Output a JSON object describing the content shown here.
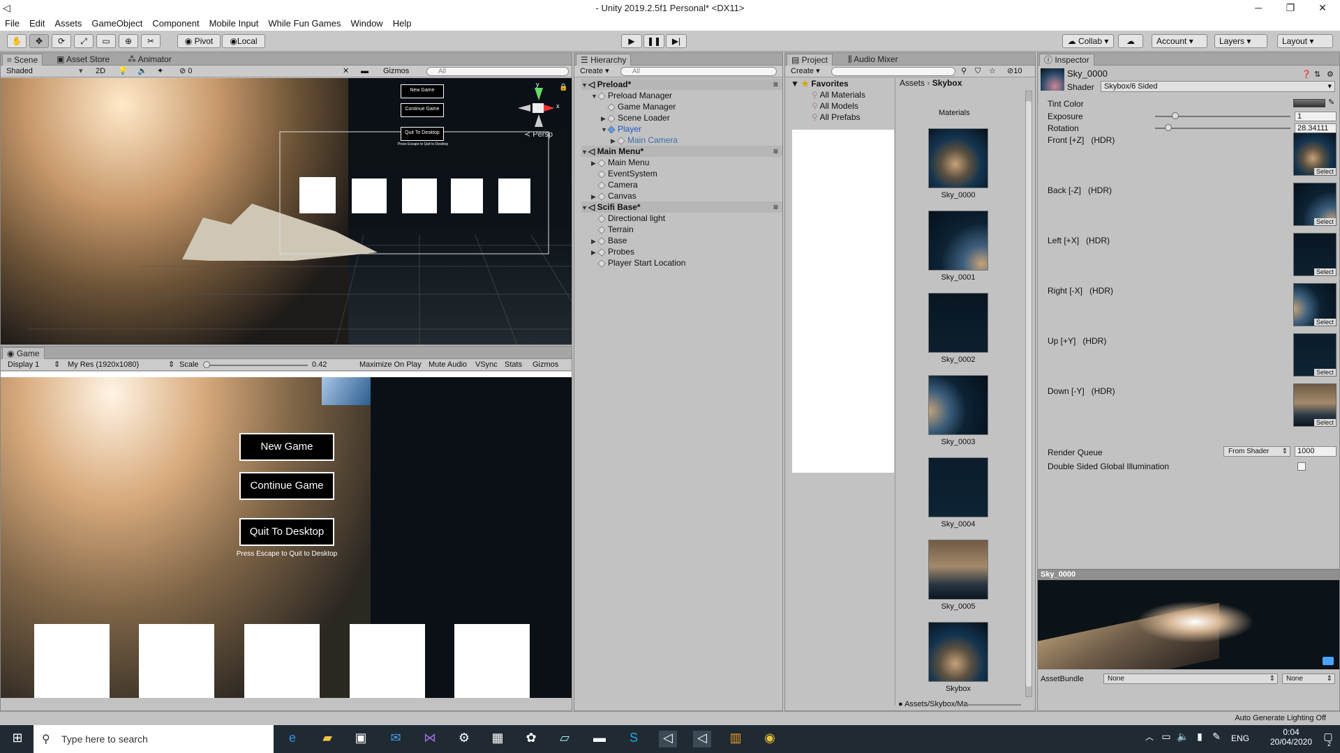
{
  "window": {
    "title": "- Unity 2019.2.5f1 Personal* <DX11>"
  },
  "menu": [
    "File",
    "Edit",
    "Assets",
    "GameObject",
    "Component",
    "Mobile Input",
    "While Fun Games",
    "Window",
    "Help"
  ],
  "toolbar": {
    "pivot": "Pivot",
    "local": "Local",
    "collab": "Collab",
    "account": "Account",
    "layers": "Layers",
    "layout": "Layout"
  },
  "scene": {
    "tabs": [
      "Scene",
      "Asset Store",
      "Animator"
    ],
    "shading": "Shaded",
    "mode2d": "2D",
    "gizmos": "Gizmos",
    "search": "All",
    "persp": "Persp",
    "count": "0"
  },
  "game": {
    "tab": "Game",
    "display": "Display 1",
    "resolution": "My Res (1920x1080)",
    "scale_label": "Scale",
    "scale_value": "0.42",
    "options": [
      "Maximize On Play",
      "Mute Audio",
      "VSync",
      "Stats",
      "Gizmos"
    ],
    "buttons": [
      "New Game",
      "Continue Game",
      "Quit To Desktop"
    ],
    "hint": "Press Escape to Quit to Desktop"
  },
  "hierarchy": {
    "tab": "Hierarchy",
    "create": "Create",
    "search": "All",
    "rows": [
      {
        "label": "Preload*",
        "depth": 0,
        "type": "scene"
      },
      {
        "label": "Preload Manager",
        "depth": 1,
        "type": "obj"
      },
      {
        "label": "Game Manager",
        "depth": 2,
        "type": "obj"
      },
      {
        "label": "Scene Loader",
        "depth": 2,
        "type": "obj"
      },
      {
        "label": "Player",
        "depth": 2,
        "type": "selected"
      },
      {
        "label": "Main Camera",
        "depth": 3,
        "type": "child"
      },
      {
        "label": "Main Menu*",
        "depth": 0,
        "type": "scene"
      },
      {
        "label": "Main Menu",
        "depth": 1,
        "type": "obj"
      },
      {
        "label": "EventSystem",
        "depth": 1,
        "type": "obj"
      },
      {
        "label": "Camera",
        "depth": 1,
        "type": "obj"
      },
      {
        "label": "Canvas",
        "depth": 1,
        "type": "obj"
      },
      {
        "label": "Scifi Base*",
        "depth": 0,
        "type": "scene"
      },
      {
        "label": "Directional light",
        "depth": 1,
        "type": "obj"
      },
      {
        "label": "Terrain",
        "depth": 1,
        "type": "obj"
      },
      {
        "label": "Base",
        "depth": 1,
        "type": "obj"
      },
      {
        "label": "Probes",
        "depth": 1,
        "type": "obj"
      },
      {
        "label": "Player Start Location",
        "depth": 1,
        "type": "obj"
      }
    ]
  },
  "project": {
    "tabs": [
      "Project",
      "Audio Mixer"
    ],
    "create": "Create",
    "count": "10",
    "favorites": "Favorites",
    "fav_items": [
      "All Materials",
      "All Models",
      "All Prefabs"
    ],
    "breadcrumb": [
      "Assets",
      "Skybox"
    ],
    "section": "Materials",
    "items": [
      "Sky_0000",
      "Sky_0001",
      "Sky_0002",
      "Sky_0003",
      "Sky_0004",
      "Sky_0005",
      "Skybox"
    ],
    "path": "Assets/Skybox/Ma"
  },
  "inspector": {
    "tab": "Inspector",
    "name": "Sky_0000",
    "shader_label": "Shader",
    "shader": "Skybox/6 Sided",
    "tint": "Tint Color",
    "exposure_label": "Exposure",
    "exposure": "1",
    "rotation_label": "Rotation",
    "rotation": "28.34111",
    "faces": [
      "Front [+Z]   (HDR)",
      "Back [-Z]   (HDR)",
      "Left [+X]   (HDR)",
      "Right [-X]   (HDR)",
      "Up [+Y]   (HDR)",
      "Down [-Y]   (HDR)"
    ],
    "select": "Select",
    "render_queue": "Render Queue",
    "from_shader": "From Shader",
    "queue_value": "1000",
    "double_sided": "Double Sided Global Illumination",
    "preview_title": "Sky_0000",
    "assetbundle": "AssetBundle",
    "none1": "None",
    "none2": "None"
  },
  "status": {
    "lighting": "Auto Generate Lighting Off"
  },
  "taskbar": {
    "search": "Type here to search",
    "lang": "ENG",
    "time": "0:04",
    "date": "20/04/2020",
    "notif": "2"
  }
}
